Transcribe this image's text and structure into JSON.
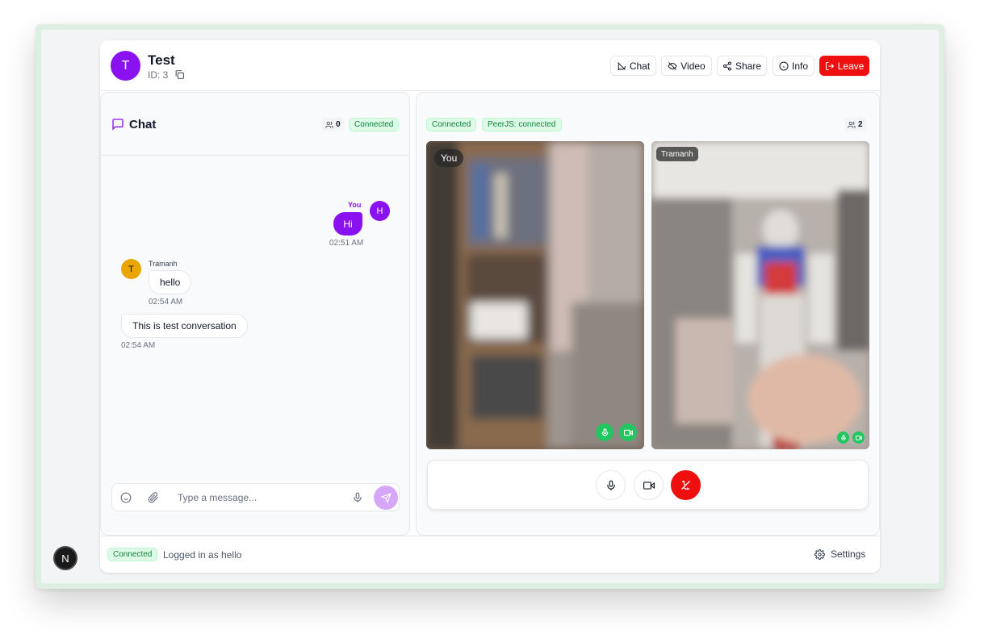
{
  "header": {
    "avatar_letter": "T",
    "title": "Test",
    "id_text": "ID: 3",
    "buttons": {
      "chat": "Chat",
      "video": "Video",
      "share": "Share",
      "info": "Info",
      "leave": "Leave"
    }
  },
  "chat": {
    "title": "Chat",
    "participant_count": "0",
    "status": "Connected",
    "messages": [
      {
        "sender": "You",
        "avatar": "H",
        "text": "Hi",
        "time": "02:51 AM"
      },
      {
        "sender": "Tramanh",
        "avatar": "T",
        "text": "hello",
        "time": "02:54 AM"
      },
      {
        "sender": "",
        "text": "This is test conversation",
        "time": "02:54 AM"
      }
    ],
    "input_placeholder": "Type a message..."
  },
  "video": {
    "status": "Connected",
    "peer_status": "PeerJS: connected",
    "participant_count": "2",
    "tiles": [
      {
        "label": "You"
      },
      {
        "label": "Tramanh"
      }
    ]
  },
  "footer": {
    "status": "Connected",
    "logged_in_text": "Logged in as hello",
    "settings": "Settings"
  },
  "dev_indicator": "N",
  "colors": {
    "accent": "#8b12f0",
    "danger": "#ef0f0f",
    "success": "#22c55e",
    "success_bg": "#dcfce7"
  },
  "icons": [
    "copy-icon",
    "chat-off-icon",
    "video-off-icon",
    "share-icon",
    "info-icon",
    "leave-icon",
    "message-square-icon",
    "users-icon",
    "smile-icon",
    "paperclip-icon",
    "mic-icon",
    "send-icon",
    "video-camera-icon",
    "phone-off-icon",
    "gear-icon"
  ]
}
